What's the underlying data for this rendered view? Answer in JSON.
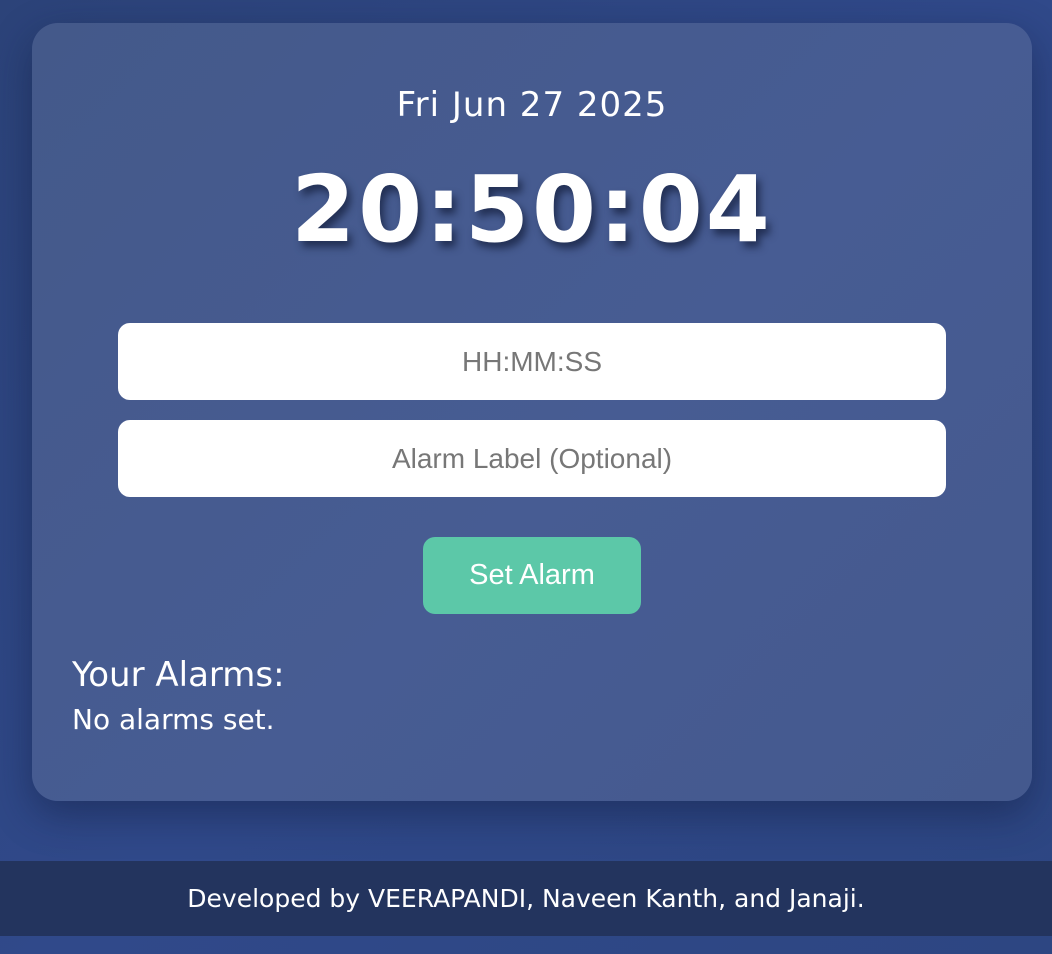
{
  "clock": {
    "date": "Fri Jun 27 2025",
    "time": "20:50:04"
  },
  "form": {
    "time_placeholder": "HH:MM:SS",
    "label_placeholder": "Alarm Label (Optional)",
    "set_button_label": "Set Alarm"
  },
  "alarms": {
    "heading": "Your Alarms:",
    "empty_message": "No alarms set."
  },
  "footer": {
    "credit": "Developed by VEERAPANDI, Naveen Kanth, and Janaji."
  },
  "colors": {
    "background": "#2e4680",
    "card": "#475c93",
    "button": "#5cc8a8",
    "footer": "#23345e",
    "text": "#ffffff"
  }
}
